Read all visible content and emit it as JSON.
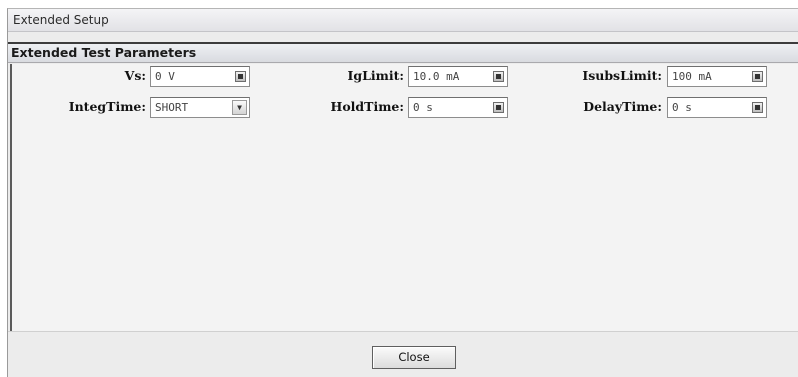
{
  "window": {
    "title": "Extended Setup"
  },
  "group": {
    "title": "Extended Test Parameters"
  },
  "fields": {
    "vs": {
      "label": "Vs:",
      "value": "0 V"
    },
    "ig_limit": {
      "label": "IgLimit:",
      "value": "10.0 mA"
    },
    "isubs_limit": {
      "label": "IsubsLimit:",
      "value": "100 mA"
    },
    "integ_time": {
      "label": "IntegTime:",
      "value": "SHORT",
      "dropdown_icon": "chevron-down-icon"
    },
    "hold_time": {
      "label": "HoldTime:",
      "value": "0 s"
    },
    "delay_time": {
      "label": "DelayTime:",
      "value": "0 s"
    }
  },
  "footer": {
    "close_label": "Close"
  }
}
